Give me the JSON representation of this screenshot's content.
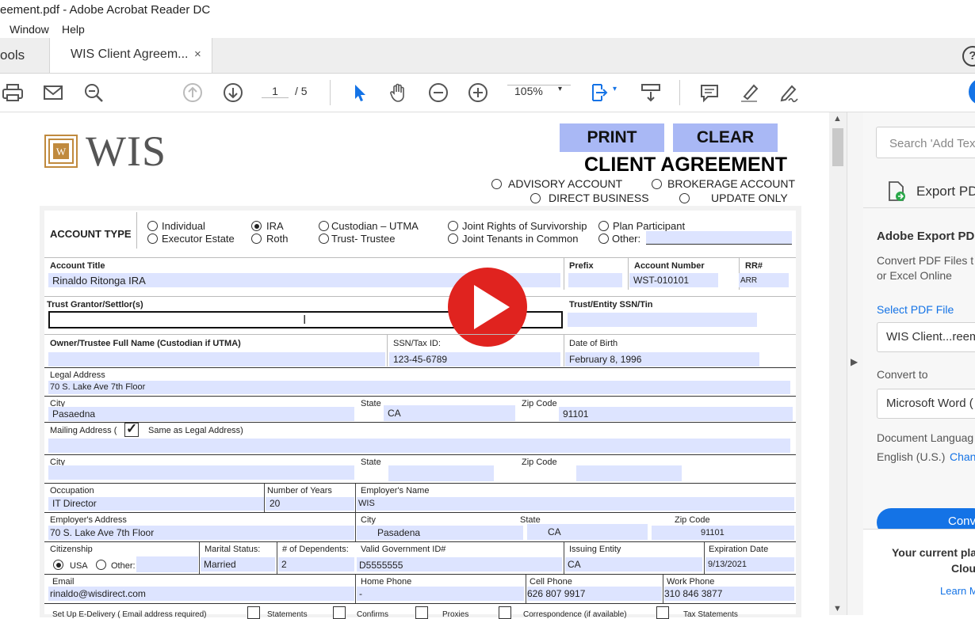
{
  "window": {
    "title": "eement.pdf - Adobe Acrobat Reader DC"
  },
  "menu": [
    "Window",
    "Help"
  ],
  "tabs": {
    "tools": "ools",
    "doc": "WIS Client Agreem...",
    "close": "×"
  },
  "help": "?",
  "toolbar": {
    "page_current": "1",
    "page_total": "/ 5",
    "zoom": "105%",
    "zoom_caret": "▾"
  },
  "right_panel": {
    "search_placeholder": "Search 'Add Tex",
    "export_label": "Export PD",
    "heading": "Adobe Export PD",
    "desc1": "Convert PDF Files t",
    "desc2": "or Excel Online",
    "select_file": "Select PDF File",
    "file_name": "WIS Client...reeme",
    "convert_to": "Convert to",
    "format": "Microsoft Word (",
    "doc_lang": "Document Languag",
    "lang": "English (U.S.)",
    "change": "Chan",
    "convert_btn": "Conve",
    "plan1": "Your current pla",
    "plan2": "Clou",
    "learn": "Learn M"
  },
  "doc": {
    "logo": "WIS",
    "logo_mark": "W",
    "print": "PRINT",
    "clear": "CLEAR",
    "title": "CLIENT AGREEMENT",
    "opt_advisory": "ADVISORY ACCOUNT",
    "opt_brokerage": "BROKERAGE ACCOUNT",
    "opt_direct": "DIRECT BUSINESS",
    "opt_update": "UPDATE ONLY",
    "account_type": "ACCOUNT TYPE",
    "types": {
      "individual": "Individual",
      "executor": "Executor Estate",
      "ira": "IRA",
      "roth": "Roth",
      "custodian": "Custodian – UTMA",
      "trust": "Trust- Trustee",
      "jtros": "Joint  Rights of Survivorship",
      "jtic": "Joint  Tenants in Common",
      "plan": "Plan Participant",
      "other": "Other:"
    },
    "account_title_lbl": "Account Title",
    "account_title": "Rinaldo Ritonga IRA",
    "prefix_lbl": "Prefix",
    "acctnum_lbl": "Account Number",
    "acctnum": "WST-010101",
    "rr_lbl": "RR#",
    "rr": "ARR",
    "trust_grantor_lbl": "Trust Grantor/Settlor(s)",
    "trust_ssn_lbl": "Trust/Entity SSN/Tin",
    "owner_lbl": "Owner/Trustee Full Name (Custodian if UTMA)",
    "ssn_lbl": "SSN/Tax ID:",
    "ssn": "123-45-6789",
    "dob_lbl": "Date of Birth",
    "dob": "February 8, 1996",
    "legal_addr_lbl": "Legal Address",
    "legal_addr": "70 S. Lake Ave 7th Floor",
    "city_lbl": "City",
    "city": "Pasaedna",
    "state_lbl": "State",
    "state": "CA",
    "zip_lbl": "Zip Code",
    "zip": "91101",
    "mailing_lbl": "Mailing Address  (",
    "same_as": "Same as Legal Address)",
    "check": "✓",
    "city2_lbl": "City",
    "state2_lbl": "State",
    "zip2_lbl": "Zip Code",
    "occupation_lbl": "Occupation",
    "occupation": "IT Director",
    "years_lbl": "Number of Years",
    "years": "20",
    "employer_lbl": "Employer's Name",
    "employer": "WIS",
    "emp_addr_lbl": "Employer's Address",
    "emp_addr": "70 S. Lake Ave 7th Floor",
    "emp_city_lbl": "City",
    "emp_city": "Pasadena",
    "emp_state_lbl": "State",
    "emp_state": "CA",
    "emp_zip_lbl": "Zip Code",
    "emp_zip": "91101",
    "citizenship_lbl": "Citizenship",
    "usa": "USA",
    "other2": "Other:",
    "marital_lbl": "Marital Status:",
    "marital": "Married",
    "dependents_lbl": "# of Dependents:",
    "dependents": "2",
    "gov_id_lbl": "Valid Government ID#",
    "gov_id": "D5555555",
    "issuing_lbl": "Issuing Entity",
    "issuing": "CA",
    "exp_lbl": "Expiration Date",
    "exp": "9/13/2021",
    "email_lbl": "Email",
    "email": "rinaldo@wisdirect.com",
    "home_lbl": "Home Phone",
    "home": "-",
    "cell_lbl": "Cell Phone",
    "cell": "626 807 9917",
    "work_lbl": "Work Phone",
    "work": "310 846 3877",
    "edelivery": "Set Up E-Delivery  ( Email address required)",
    "stmts": "Statements",
    "confirms": "Confirms",
    "proxies": "Proxies",
    "corr": "Correspondence (if available)",
    "tax": "Tax Statements"
  },
  "colors": {
    "accent": "#1473e6",
    "field": "#dde4ff",
    "button": "#a9b8f5",
    "play": "#e0231f"
  }
}
